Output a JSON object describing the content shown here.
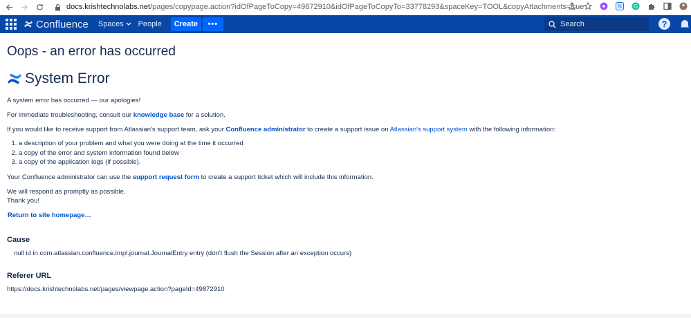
{
  "browser": {
    "back_icon": "arrow-left-icon",
    "forward_icon": "arrow-right-icon",
    "reload_icon": "reload-icon",
    "lock_icon": "lock-icon",
    "url_domain": "docs.krishtechnolabs.net",
    "url_rest": "/pages/copypage.action?idOfPageToCopy=49872910&idOfPageToCopyTo=33778293&spaceKey=TOOL&copyAttachments=true"
  },
  "header": {
    "product_name": "Confluence",
    "nav_spaces": "Spaces",
    "nav_people": "People",
    "create_label": "Create",
    "more_label": "•••",
    "search_placeholder": "Search",
    "help_label": "?",
    "colors": {
      "bar": "#0747a6",
      "button": "#0065ff",
      "text": "#deebff"
    }
  },
  "page": {
    "title": "Oops - an error has occurred",
    "system_error": "System Error",
    "apology": "A system error has occurred — our apologies!",
    "troubleshoot_prefix": "For immediate troubleshooting, consult our ",
    "knowledge_base": "knowledge base",
    "troubleshoot_suffix": " for a solution.",
    "support_prefix": "If you would like to receive support from Atlassian's support team, ask your ",
    "confluence_admin": "Confluence administrator",
    "support_mid": " to create a support issue on ",
    "support_system": "Atlassian's support system",
    "support_suffix": " with the following information:",
    "info_items": [
      "a description of your problem and what you were doing at the time it occurred",
      "a copy of the error and system information found below",
      "a copy of the application logs (if possible)."
    ],
    "form_prefix": "Your Confluence administrator can use the ",
    "support_request_form": "support request form",
    "form_suffix": " to create a support ticket which will include this information.",
    "respond": "We will respond as promptly as possible.",
    "thanks": "Thank you!",
    "return_link": "Return to site homepage…",
    "cause_title": "Cause",
    "cause_value": "null id in com.atlassian.confluence.impl.journal.JournalEntry entry (don't flush the Session after an exception occurs)",
    "referer_title": "Referer URL",
    "referer_value": "https://docs.krishtechnolabs.net/pages/viewpage.action?pageId=49872910"
  }
}
